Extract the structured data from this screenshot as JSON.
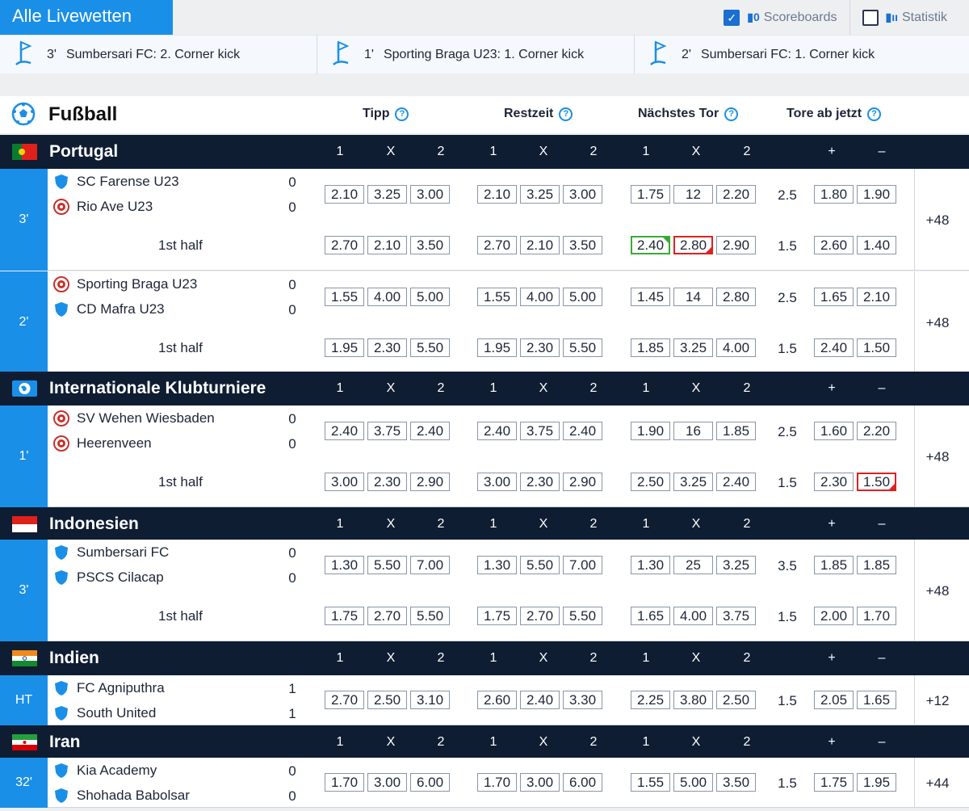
{
  "header": {
    "title": "Alle Livewetten",
    "scoreboards_label": "Scoreboards",
    "scoreboards_checked": true,
    "statistik_label": "Statistik",
    "statistik_checked": false
  },
  "ticker": [
    {
      "minute": "3'",
      "text": "Sumbersari FC: 2. Corner kick",
      "icon": "corner-flag-icon"
    },
    {
      "minute": "1'",
      "text": "Sporting Braga U23: 1. Corner kick",
      "icon": "corner-flag-icon"
    },
    {
      "minute": "2'",
      "text": "Sumbersari FC: 1. Corner kick",
      "icon": "corner-flag-icon"
    }
  ],
  "sport": {
    "name": "Fußball",
    "icon": "soccer-ball-icon",
    "columns": [
      "Tipp",
      "Restzeit",
      "Nächstes Tor",
      "Tore ab jetzt"
    ]
  },
  "colors": {
    "accent": "#1a8fe8",
    "league_bar": "#0f1d33",
    "odd_up": "#3aaa35",
    "odd_down": "#e02020"
  },
  "leagues": [
    {
      "name": "Portugal",
      "flag": "portugal",
      "labels": [
        "1",
        "X",
        "2",
        "1",
        "X",
        "2",
        "1",
        "X",
        "2",
        "+",
        "–"
      ],
      "matches": [
        {
          "time": "3'",
          "home": "SC Farense U23",
          "away": "Rio Ave U23",
          "home_score": "0",
          "away_score": "0",
          "home_icon": "shield-icon",
          "away_icon": "club-crest-icon",
          "rows": [
            {
              "label": "",
              "tipp": [
                "2.10",
                "3.25",
                "3.00"
              ],
              "rest": [
                "2.10",
                "3.25",
                "3.00"
              ],
              "next": [
                "1.75",
                "12",
                "2.20"
              ],
              "line": "2.5",
              "ou": [
                "1.80",
                "1.90"
              ]
            },
            {
              "label": "1st half",
              "tipp": [
                "2.70",
                "2.10",
                "3.50"
              ],
              "rest": [
                "2.70",
                "2.10",
                "3.50"
              ],
              "next": [
                "2.40",
                "2.80",
                "2.90"
              ],
              "next_state": [
                "up",
                "down",
                ""
              ],
              "line": "1.5",
              "ou": [
                "2.60",
                "1.40"
              ]
            }
          ],
          "more": "+48"
        },
        {
          "time": "2'",
          "home": "Sporting Braga U23",
          "away": "CD Mafra U23",
          "home_score": "0",
          "away_score": "0",
          "home_icon": "club-crest-icon",
          "away_icon": "shield-icon",
          "rows": [
            {
              "label": "",
              "tipp": [
                "1.55",
                "4.00",
                "5.00"
              ],
              "rest": [
                "1.55",
                "4.00",
                "5.00"
              ],
              "next": [
                "1.45",
                "14",
                "2.80"
              ],
              "line": "2.5",
              "ou": [
                "1.65",
                "2.10"
              ]
            },
            {
              "label": "1st half",
              "tipp": [
                "1.95",
                "2.30",
                "5.50"
              ],
              "rest": [
                "1.95",
                "2.30",
                "5.50"
              ],
              "next": [
                "1.85",
                "3.25",
                "4.00"
              ],
              "line": "1.5",
              "ou": [
                "2.40",
                "1.50"
              ]
            }
          ],
          "more": "+48"
        }
      ]
    },
    {
      "name": "Internationale Klubturniere",
      "flag": "globe",
      "labels": [
        "1",
        "X",
        "2",
        "1",
        "X",
        "2",
        "1",
        "X",
        "2",
        "+",
        "–"
      ],
      "matches": [
        {
          "time": "1'",
          "home": "SV Wehen Wiesbaden",
          "away": "Heerenveen",
          "home_score": "0",
          "away_score": "0",
          "home_icon": "club-crest-icon",
          "away_icon": "club-crest-icon",
          "rows": [
            {
              "label": "",
              "tipp": [
                "2.40",
                "3.75",
                "2.40"
              ],
              "rest": [
                "2.40",
                "3.75",
                "2.40"
              ],
              "next": [
                "1.90",
                "16",
                "1.85"
              ],
              "line": "2.5",
              "ou": [
                "1.60",
                "2.20"
              ]
            },
            {
              "label": "1st half",
              "tipp": [
                "3.00",
                "2.30",
                "2.90"
              ],
              "rest": [
                "3.00",
                "2.30",
                "2.90"
              ],
              "next": [
                "2.50",
                "3.25",
                "2.40"
              ],
              "line": "1.5",
              "ou": [
                "2.30",
                "1.50"
              ],
              "ou_state": [
                "",
                "down"
              ]
            }
          ],
          "more": "+48"
        }
      ]
    },
    {
      "name": "Indonesien",
      "flag": "indonesia",
      "labels": [
        "1",
        "X",
        "2",
        "1",
        "X",
        "2",
        "1",
        "X",
        "2",
        "+",
        "–"
      ],
      "matches": [
        {
          "time": "3'",
          "home": "Sumbersari FC",
          "away": "PSCS Cilacap",
          "home_score": "0",
          "away_score": "0",
          "home_icon": "shield-icon",
          "away_icon": "shield-icon",
          "rows": [
            {
              "label": "",
              "tipp": [
                "1.30",
                "5.50",
                "7.00"
              ],
              "rest": [
                "1.30",
                "5.50",
                "7.00"
              ],
              "next": [
                "1.30",
                "25",
                "3.25"
              ],
              "line": "3.5",
              "ou": [
                "1.85",
                "1.85"
              ]
            },
            {
              "label": "1st half",
              "tipp": [
                "1.75",
                "2.70",
                "5.50"
              ],
              "rest": [
                "1.75",
                "2.70",
                "5.50"
              ],
              "next": [
                "1.65",
                "4.00",
                "3.75"
              ],
              "line": "1.5",
              "ou": [
                "2.00",
                "1.70"
              ]
            }
          ],
          "more": "+48"
        }
      ]
    },
    {
      "name": "Indien",
      "flag": "india",
      "labels": [
        "1",
        "X",
        "2",
        "1",
        "X",
        "2",
        "1",
        "X",
        "2",
        "+",
        "–"
      ],
      "matches": [
        {
          "time": "HT",
          "home": "FC Agniputhra",
          "away": "South United",
          "home_score": "1",
          "away_score": "1",
          "home_icon": "shield-icon",
          "away_icon": "shield-icon",
          "rows": [
            {
              "label": "",
              "tipp": [
                "2.70",
                "2.50",
                "3.10"
              ],
              "rest": [
                "2.60",
                "2.40",
                "3.30"
              ],
              "next": [
                "2.25",
                "3.80",
                "2.50"
              ],
              "line": "1.5",
              "ou": [
                "2.05",
                "1.65"
              ]
            }
          ],
          "more": "+12"
        }
      ]
    },
    {
      "name": "Iran",
      "flag": "iran",
      "labels": [
        "1",
        "X",
        "2",
        "1",
        "X",
        "2",
        "1",
        "X",
        "2",
        "+",
        "–"
      ],
      "matches": [
        {
          "time": "32'",
          "home": "Kia Academy",
          "away": "Shohada Babolsar",
          "home_score": "0",
          "away_score": "0",
          "home_icon": "shield-icon",
          "away_icon": "shield-icon",
          "rows": [
            {
              "label": "",
              "tipp": [
                "1.70",
                "3.00",
                "6.00"
              ],
              "rest": [
                "1.70",
                "3.00",
                "6.00"
              ],
              "next": [
                "1.55",
                "5.00",
                "3.50"
              ],
              "line": "1.5",
              "ou": [
                "1.75",
                "1.95"
              ]
            }
          ],
          "more": "+44"
        }
      ]
    }
  ]
}
